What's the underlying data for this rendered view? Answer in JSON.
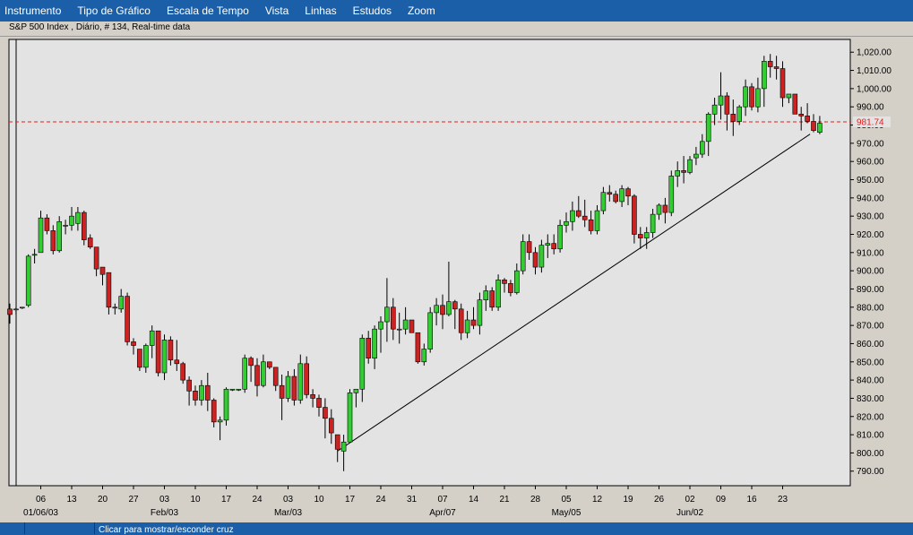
{
  "menu": [
    {
      "label": "Instrumento"
    },
    {
      "label": "Tipo de Gráfico"
    },
    {
      "label": "Escala de Tempo"
    },
    {
      "label": "Vista"
    },
    {
      "label": "Linhas"
    },
    {
      "label": "Estudos"
    },
    {
      "label": "Zoom"
    }
  ],
  "chart_title": "S&P 500 Index , Diário, # 134, Real-time data",
  "status": {
    "text": "Clicar para mostrar/esconder cruz"
  },
  "colors": {
    "background": "#1a5fa8",
    "plot_bg": "#e3e3e3",
    "up_candle": "#33cc33",
    "down_candle": "#cc2222",
    "price_line": "#e02020",
    "trendline": "#000000"
  },
  "chart_data": {
    "type": "candlestick",
    "title": "S&P 500 Index , Diário, # 134, Real-time data",
    "ylim": [
      782,
      1027
    ],
    "y_ticks": [
      790,
      800,
      810,
      820,
      830,
      840,
      850,
      860,
      870,
      880,
      890,
      900,
      910,
      920,
      930,
      940,
      950,
      960,
      970,
      980,
      990,
      1000,
      1010,
      1020
    ],
    "y_tick_labels": [
      "790.00",
      "800.00",
      "810.00",
      "820.00",
      "830.00",
      "840.00",
      "850.00",
      "860.00",
      "870.00",
      "880.00",
      "890.00",
      "900.00",
      "910.00",
      "920.00",
      "930.00",
      "940.00",
      "950.00",
      "960.00",
      "970.00",
      "980.00",
      "990.00",
      "1,000.00",
      "1,010.00",
      "1,020.00"
    ],
    "day_labels": [
      {
        "i": 5,
        "label": "06"
      },
      {
        "i": 10,
        "label": "13"
      },
      {
        "i": 15,
        "label": "20"
      },
      {
        "i": 20,
        "label": "27"
      },
      {
        "i": 25,
        "label": "03"
      },
      {
        "i": 30,
        "label": "10"
      },
      {
        "i": 35,
        "label": "17"
      },
      {
        "i": 40,
        "label": "24"
      },
      {
        "i": 45,
        "label": "03"
      },
      {
        "i": 50,
        "label": "10"
      },
      {
        "i": 55,
        "label": "17"
      },
      {
        "i": 60,
        "label": "24"
      },
      {
        "i": 65,
        "label": "31"
      },
      {
        "i": 70,
        "label": "07"
      },
      {
        "i": 75,
        "label": "14"
      },
      {
        "i": 80,
        "label": "21"
      },
      {
        "i": 85,
        "label": "28"
      },
      {
        "i": 90,
        "label": "05"
      },
      {
        "i": 95,
        "label": "12"
      },
      {
        "i": 100,
        "label": "19"
      },
      {
        "i": 105,
        "label": "26"
      },
      {
        "i": 110,
        "label": "02"
      },
      {
        "i": 115,
        "label": "09"
      },
      {
        "i": 120,
        "label": "16"
      },
      {
        "i": 125,
        "label": "23"
      }
    ],
    "month_labels": [
      {
        "i": 5,
        "label": "01/06/03"
      },
      {
        "i": 25,
        "label": "Feb/03"
      },
      {
        "i": 45,
        "label": "Mar/03"
      },
      {
        "i": 70,
        "label": "Apr/07"
      },
      {
        "i": 90,
        "label": "May/05"
      },
      {
        "i": 110,
        "label": "Jun/02"
      }
    ],
    "current_price": 981.74,
    "current_price_label": "981.74",
    "trendline": {
      "start": {
        "i": 53,
        "value": 801
      },
      "end": {
        "i": 129,
        "value": 975
      }
    },
    "ohlc": [
      [
        879,
        882,
        871,
        876
      ],
      [
        879,
        880,
        876,
        879
      ],
      [
        880,
        880,
        879,
        880
      ],
      [
        881,
        909,
        880,
        908
      ],
      [
        909,
        912,
        904,
        909
      ],
      [
        910,
        933,
        910,
        929
      ],
      [
        929,
        931,
        920,
        922
      ],
      [
        922,
        925,
        909,
        911
      ],
      [
        911,
        930,
        910,
        927
      ],
      [
        925,
        928,
        920,
        925
      ],
      [
        925,
        935,
        922,
        930
      ],
      [
        926,
        935,
        922,
        932
      ],
      [
        932,
        933,
        914,
        917
      ],
      [
        918,
        920,
        912,
        913
      ],
      [
        913,
        906,
        897,
        901
      ],
      [
        902,
        900,
        892,
        898
      ],
      [
        899,
        891,
        876,
        880
      ],
      [
        880,
        882,
        876,
        880
      ],
      [
        879,
        890,
        877,
        886
      ],
      [
        886,
        888,
        859,
        861
      ],
      [
        861,
        863,
        854,
        859
      ],
      [
        857,
        856,
        845,
        847
      ],
      [
        847,
        860,
        844,
        859
      ],
      [
        859,
        870,
        852,
        867
      ],
      [
        867,
        866,
        842,
        844
      ],
      [
        844,
        865,
        840,
        862
      ],
      [
        862,
        864,
        848,
        851
      ],
      [
        851,
        862,
        845,
        849
      ],
      [
        849,
        850,
        838,
        840
      ],
      [
        840,
        842,
        826,
        834
      ],
      [
        834,
        837,
        826,
        829
      ],
      [
        829,
        840,
        826,
        837
      ],
      [
        837,
        844,
        823,
        829
      ],
      [
        829,
        830,
        814,
        817
      ],
      [
        817,
        820,
        807,
        818
      ],
      [
        818,
        836,
        815,
        835
      ],
      [
        835,
        835,
        834,
        835
      ],
      [
        835,
        835,
        834,
        835
      ],
      [
        835,
        854,
        833,
        852
      ],
      [
        852,
        853,
        839,
        848
      ],
      [
        848,
        852,
        831,
        837
      ],
      [
        837,
        854,
        836,
        850
      ],
      [
        850,
        850,
        846,
        847
      ],
      [
        847,
        846,
        834,
        837
      ],
      [
        837,
        843,
        818,
        830
      ],
      [
        830,
        845,
        828,
        842
      ],
      [
        842,
        846,
        826,
        829
      ],
      [
        829,
        854,
        827,
        849
      ],
      [
        849,
        853,
        830,
        832
      ],
      [
        832,
        835,
        825,
        830
      ],
      [
        830,
        832,
        820,
        825
      ],
      [
        825,
        830,
        808,
        819
      ],
      [
        819,
        824,
        805,
        811
      ],
      [
        810,
        809,
        795,
        802
      ],
      [
        801,
        810,
        790,
        806
      ],
      [
        806,
        835,
        806,
        833
      ],
      [
        833,
        835,
        825,
        835
      ],
      [
        835,
        865,
        828,
        863
      ],
      [
        863,
        867,
        849,
        852
      ],
      [
        852,
        870,
        846,
        868
      ],
      [
        868,
        875,
        855,
        872
      ],
      [
        872,
        896,
        861,
        880
      ],
      [
        880,
        885,
        862,
        868
      ],
      [
        868,
        877,
        860,
        868
      ],
      [
        868,
        880,
        865,
        873
      ],
      [
        873,
        872,
        866,
        866
      ],
      [
        866,
        866,
        849,
        850
      ],
      [
        850,
        860,
        848,
        857
      ],
      [
        857,
        880,
        855,
        877
      ],
      [
        877,
        885,
        870,
        881
      ],
      [
        881,
        887,
        868,
        876
      ],
      [
        876,
        905,
        875,
        883
      ],
      [
        883,
        884,
        868,
        879
      ],
      [
        879,
        882,
        862,
        866
      ],
      [
        866,
        878,
        863,
        873
      ],
      [
        873,
        880,
        868,
        870
      ],
      [
        870,
        888,
        865,
        884
      ],
      [
        884,
        892,
        878,
        889
      ],
      [
        889,
        891,
        878,
        880
      ],
      [
        880,
        898,
        878,
        895
      ],
      [
        895,
        896,
        888,
        893
      ],
      [
        893,
        895,
        886,
        888
      ],
      [
        888,
        904,
        887,
        900
      ],
      [
        900,
        920,
        898,
        916
      ],
      [
        916,
        920,
        906,
        910
      ],
      [
        910,
        913,
        898,
        902
      ],
      [
        902,
        917,
        899,
        914
      ],
      [
        914,
        920,
        907,
        915
      ],
      [
        915,
        920,
        909,
        912
      ],
      [
        912,
        928,
        910,
        925
      ],
      [
        925,
        932,
        921,
        927
      ],
      [
        927,
        938,
        922,
        933
      ],
      [
        933,
        941,
        929,
        930
      ],
      [
        930,
        939,
        924,
        928
      ],
      [
        928,
        933,
        920,
        922
      ],
      [
        922,
        936,
        920,
        933
      ],
      [
        933,
        946,
        931,
        943
      ],
      [
        943,
        947,
        938,
        942
      ],
      [
        942,
        944,
        937,
        938
      ],
      [
        938,
        947,
        935,
        945
      ],
      [
        945,
        946,
        936,
        941
      ],
      [
        941,
        942,
        915,
        920
      ],
      [
        920,
        924,
        912,
        918
      ],
      [
        918,
        924,
        912,
        921
      ],
      [
        921,
        934,
        918,
        931
      ],
      [
        931,
        937,
        928,
        936
      ],
      [
        936,
        940,
        926,
        932
      ],
      [
        932,
        955,
        930,
        952
      ],
      [
        952,
        960,
        946,
        955
      ],
      [
        955,
        963,
        948,
        954
      ],
      [
        954,
        963,
        953,
        961
      ],
      [
        962,
        968,
        958,
        964
      ],
      [
        964,
        975,
        962,
        971
      ],
      [
        971,
        987,
        963,
        986
      ],
      [
        986,
        995,
        980,
        991
      ],
      [
        991,
        1009,
        983,
        996
      ],
      [
        996,
        998,
        977,
        986
      ],
      [
        986,
        994,
        974,
        982
      ],
      [
        982,
        991,
        980,
        990
      ],
      [
        990,
        1005,
        985,
        1001
      ],
      [
        1001,
        1003,
        988,
        990
      ],
      [
        990,
        1006,
        987,
        1000
      ],
      [
        1000,
        1018,
        990,
        1015
      ],
      [
        1015,
        1019,
        1006,
        1012
      ],
      [
        1012,
        1018,
        1005,
        1011
      ],
      [
        1011,
        1015,
        990,
        995
      ],
      [
        995,
        997,
        992,
        997
      ],
      [
        997,
        996,
        986,
        986
      ],
      [
        986,
        990,
        977,
        985
      ],
      [
        985,
        992,
        981,
        982
      ],
      [
        982,
        986,
        976,
        977
      ],
      [
        976,
        985,
        975,
        981
      ]
    ]
  }
}
